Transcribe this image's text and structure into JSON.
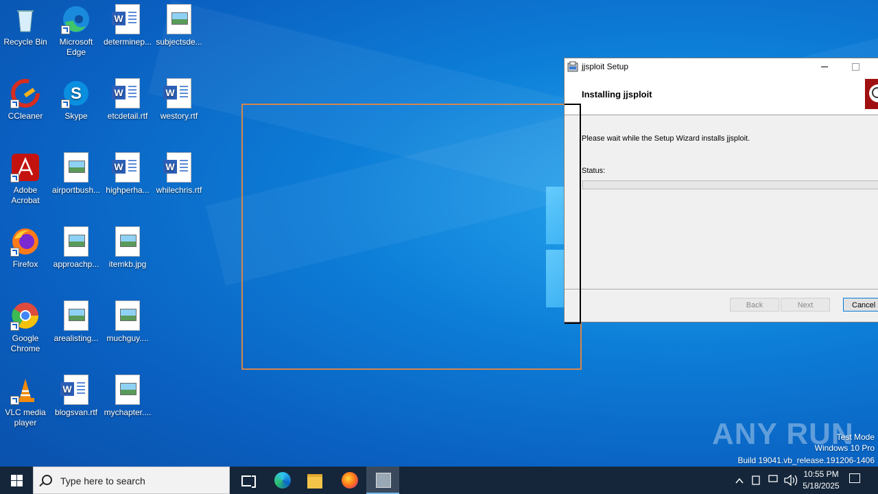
{
  "desktop_icons": [
    {
      "label": "Recycle Bin",
      "type": "recycle",
      "shortcut": false
    },
    {
      "label": "Microsoft Edge",
      "type": "edge",
      "shortcut": true
    },
    {
      "label": "determinep...",
      "type": "word",
      "shortcut": false
    },
    {
      "label": "subjectsde...",
      "type": "image",
      "shortcut": false
    },
    {
      "label": "CCleaner",
      "type": "ccleaner",
      "shortcut": true
    },
    {
      "label": "Skype",
      "type": "skype",
      "shortcut": true
    },
    {
      "label": "etcdetail.rtf",
      "type": "word",
      "shortcut": false
    },
    {
      "label": "westory.rtf",
      "type": "word",
      "shortcut": false
    },
    {
      "label": "Adobe Acrobat",
      "type": "acrobat",
      "shortcut": true
    },
    {
      "label": "airportbush...",
      "type": "image",
      "shortcut": false
    },
    {
      "label": "highperha...",
      "type": "word",
      "shortcut": false
    },
    {
      "label": "whilechris.rtf",
      "type": "word",
      "shortcut": false
    },
    {
      "label": "Firefox",
      "type": "firefox",
      "shortcut": true
    },
    {
      "label": "approachp...",
      "type": "image",
      "shortcut": false
    },
    {
      "label": "itemkb.jpg",
      "type": "image",
      "shortcut": false
    },
    {
      "label": "Google Chrome",
      "type": "chrome",
      "shortcut": true
    },
    {
      "label": "arealisting...",
      "type": "image",
      "shortcut": false
    },
    {
      "label": "muchguy....",
      "type": "image",
      "shortcut": false
    },
    {
      "label": "VLC media player",
      "type": "vlc",
      "shortcut": true
    },
    {
      "label": "blogsvan.rtf",
      "type": "word",
      "shortcut": false
    },
    {
      "label": "mychapter....",
      "type": "image",
      "shortcut": false
    }
  ],
  "setup_window": {
    "title": "jjsploit Setup",
    "header_title": "Installing jjsploit",
    "message": "Please wait while the Setup Wizard installs jjsploit.",
    "status_label": "Status:",
    "progress": 0,
    "buttons": {
      "back": "Back",
      "next": "Next",
      "cancel": "Cancel"
    }
  },
  "watermark": {
    "logo": "ANY RUN",
    "line1": "Test Mode",
    "line2": "Windows 10 Pro",
    "line3": "Build 19041.vb_release.191206-1406"
  },
  "taskbar": {
    "search_placeholder": "Type here to search",
    "time": "10:55 PM",
    "date": "5/18/2025"
  }
}
